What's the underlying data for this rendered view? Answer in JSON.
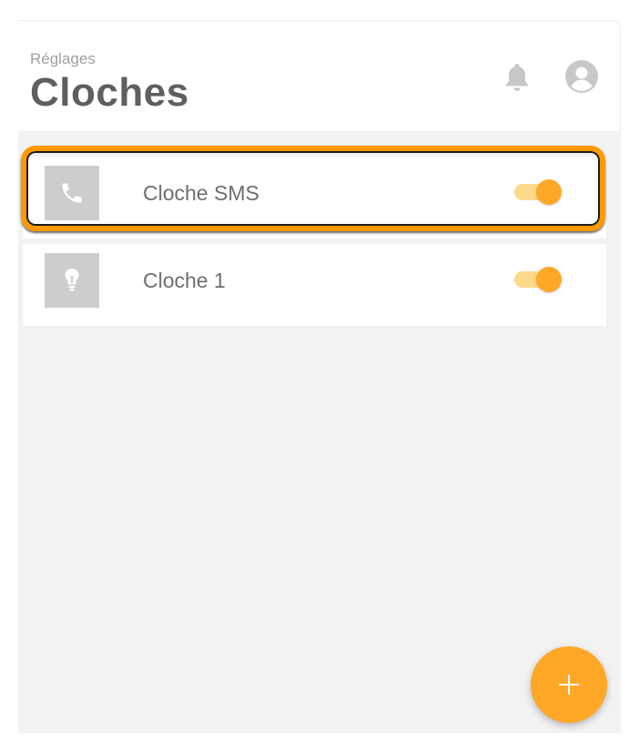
{
  "header": {
    "breadcrumb": "Réglages",
    "title": "Cloches",
    "icons": [
      "bell-icon",
      "user-icon"
    ]
  },
  "bells": [
    {
      "label": "Cloche SMS",
      "icon": "phone-icon",
      "enabled": true,
      "highlighted": true
    },
    {
      "label": "Cloche 1",
      "icon": "lightbulb-icon",
      "enabled": true,
      "highlighted": false
    }
  ],
  "fab": {
    "icon": "plus-icon"
  },
  "colors": {
    "accent": "#ffa726",
    "toggle_track": "#ffd98a",
    "highlight": "#ff9900",
    "title": "#5f5f5f",
    "background": "#f2f2f2"
  }
}
